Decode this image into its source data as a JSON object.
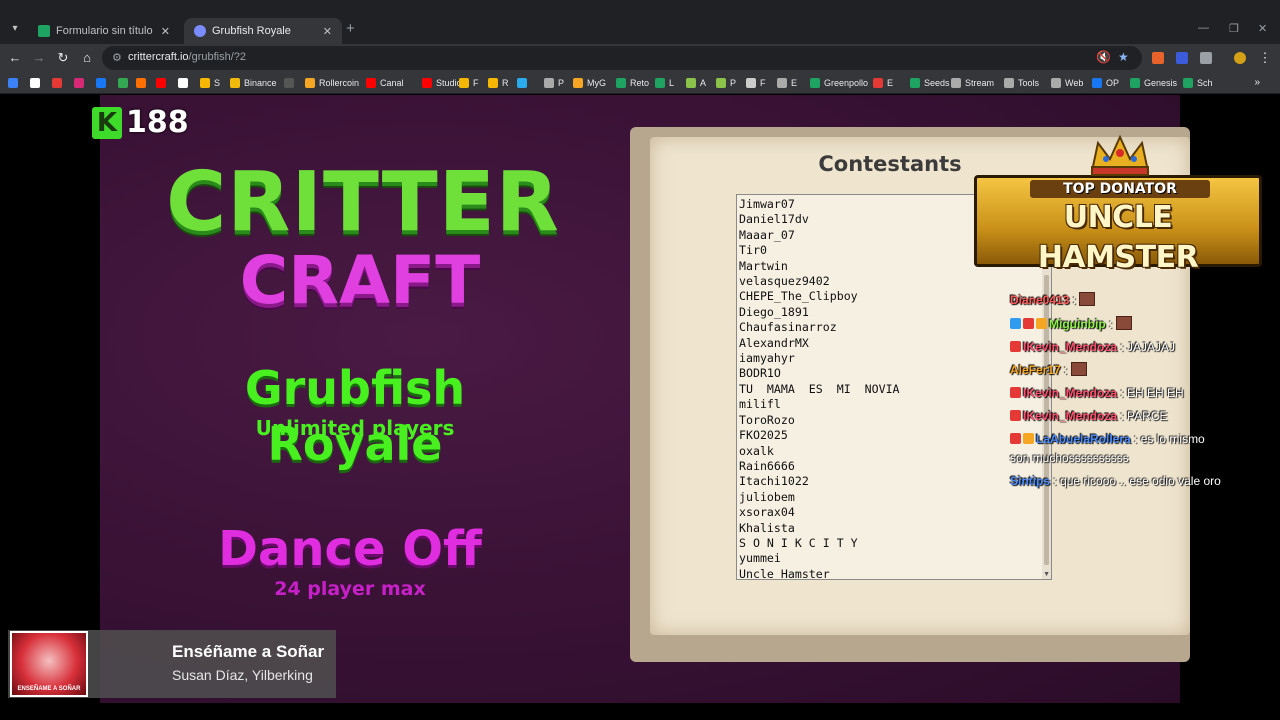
{
  "browser": {
    "tabs": [
      {
        "title": "Formulario sin título (Respuestas)",
        "favicon_color": "#1ea362",
        "active": false
      },
      {
        "title": "Grubfish Royale",
        "favicon_color": "#7b8cff",
        "active": true
      }
    ],
    "new_tab_icon": "plus-icon",
    "url_host": "crittercraft.io",
    "url_path": "/grubfish/?2",
    "bookmarks": [
      {
        "label": "",
        "color": "#3b82f6"
      },
      {
        "label": "",
        "color": "#ffffff"
      },
      {
        "label": "",
        "color": "#e53935"
      },
      {
        "label": "",
        "color": "#d62976"
      },
      {
        "label": "",
        "color": "#1877f2"
      },
      {
        "label": "",
        "color": "#34a853"
      },
      {
        "label": "",
        "color": "#ff6f00"
      },
      {
        "label": "",
        "color": "#ff0000"
      },
      {
        "label": "",
        "color": "#ffffff"
      },
      {
        "label": "S",
        "color": "#f5b700"
      },
      {
        "label": "Binance",
        "color": "#f0b90b"
      },
      {
        "label": "",
        "color": "#555555"
      },
      {
        "label": "Rollercoin",
        "color": "#f5a623"
      },
      {
        "label": "Canal",
        "color": "#ff0000"
      },
      {
        "label": "Studio",
        "color": "#ff0000"
      },
      {
        "label": "F",
        "color": "#f5b700"
      },
      {
        "label": "R",
        "color": "#f5b700"
      },
      {
        "label": "",
        "color": "#2aabee"
      },
      {
        "label": "P",
        "color": "#aaaaaa"
      },
      {
        "label": "MyG",
        "color": "#f5a623"
      },
      {
        "label": "Reto",
        "color": "#1ea362"
      },
      {
        "label": "L",
        "color": "#1ea362"
      },
      {
        "label": "A",
        "color": "#8bc34a"
      },
      {
        "label": "P",
        "color": "#8bc34a"
      },
      {
        "label": "F",
        "color": "#cccccc"
      },
      {
        "label": "E",
        "color": "#aaaaaa"
      },
      {
        "label": "Greenpollo",
        "color": "#1ea362"
      },
      {
        "label": "E",
        "color": "#e53935"
      },
      {
        "label": "Seeds",
        "color": "#1ea362"
      },
      {
        "label": "Stream",
        "color": "#aaaaaa"
      },
      {
        "label": "Tools",
        "color": "#aaaaaa"
      },
      {
        "label": "Web",
        "color": "#aaaaaa"
      },
      {
        "label": "OP",
        "color": "#1877f2"
      },
      {
        "label": "Genesis",
        "color": "#1ea362"
      },
      {
        "label": "Sch",
        "color": "#1ea362"
      }
    ]
  },
  "game": {
    "k_count": "188",
    "logo_top": "CRITTER",
    "logo_bottom": "CRAFT",
    "mode1_title": "Grubfish Royale",
    "mode1_sub": "Unlimited players",
    "mode2_title": "Dance Off",
    "mode2_sub": "24 player max",
    "contestants_title": "Contestants",
    "contestants": [
      "Jimwar07",
      "Daniel17dv",
      "Maaar_07",
      "Tir0",
      "Martwin",
      "velasquez9402",
      "CHEPE_The_Clipboy",
      "Diego_1891",
      "Chaufasinarroz",
      "AlexandrMX",
      "iamyahyr",
      "BODR1O",
      "TU  MAMA  ES  MI  NOVIA",
      "milifl",
      "ToroRozo",
      "FKO2025",
      "oxalk",
      "Rain6666",
      "Itachi1022",
      "juliobem",
      "xsorax04",
      "Khalista",
      "S O N I K C I T Y",
      "yummei",
      "Uncle Hamster"
    ]
  },
  "donator": {
    "label": "TOP DONATOR",
    "name": "UNCLE HAMSTER"
  },
  "chat": [
    {
      "user": "Diane0413",
      "sep": " : ",
      "text": "",
      "color": "#ff5a5a",
      "emote": true,
      "badges": []
    },
    {
      "user": "Miguinbip",
      "sep": " : ",
      "text": "",
      "color": "#8ef04a",
      "emote": true,
      "badges": [
        "#2f9cf0",
        "#e53935",
        "#f5a623"
      ]
    },
    {
      "user": "IKevin_Mendoza",
      "sep": " : ",
      "text": "JAJAJAJ",
      "color": "#ff4f6e",
      "emote": false,
      "badges": [
        "#e53935"
      ]
    },
    {
      "user": "AleFer17",
      "sep": " : ",
      "text": "",
      "color": "#f5a623",
      "emote": true,
      "badges": []
    },
    {
      "user": "IKevin_Mendoza",
      "sep": " : ",
      "text": "EH EH EH",
      "color": "#ff4f6e",
      "emote": false,
      "badges": [
        "#e53935"
      ]
    },
    {
      "user": "IKevin_Mendoza",
      "sep": " : ",
      "text": "PARCE",
      "color": "#ff4f6e",
      "emote": false,
      "badges": [
        "#e53935"
      ]
    },
    {
      "user": "LaAbuelaRollera",
      "sep": " : ",
      "text": "es lo mismo",
      "color": "#4a8cff",
      "emote": false,
      "badges": [
        "#e53935",
        "#f5a623"
      ]
    },
    {
      "user": "",
      "sep": "",
      "text": "son muchossssssssss",
      "color": "#ffffff",
      "emote": false,
      "badges": []
    },
    {
      "user": "Sintips",
      "sep": " : ",
      "text": "que ricooo .. ese odio vale oro",
      "color": "#4a8cff",
      "emote": false,
      "badges": []
    }
  ],
  "now_playing": {
    "title": "Enséñame a Soñar",
    "artist": "Susan Díaz, Yilberking",
    "art_text": "ENSEÑAME A SOÑAR"
  }
}
